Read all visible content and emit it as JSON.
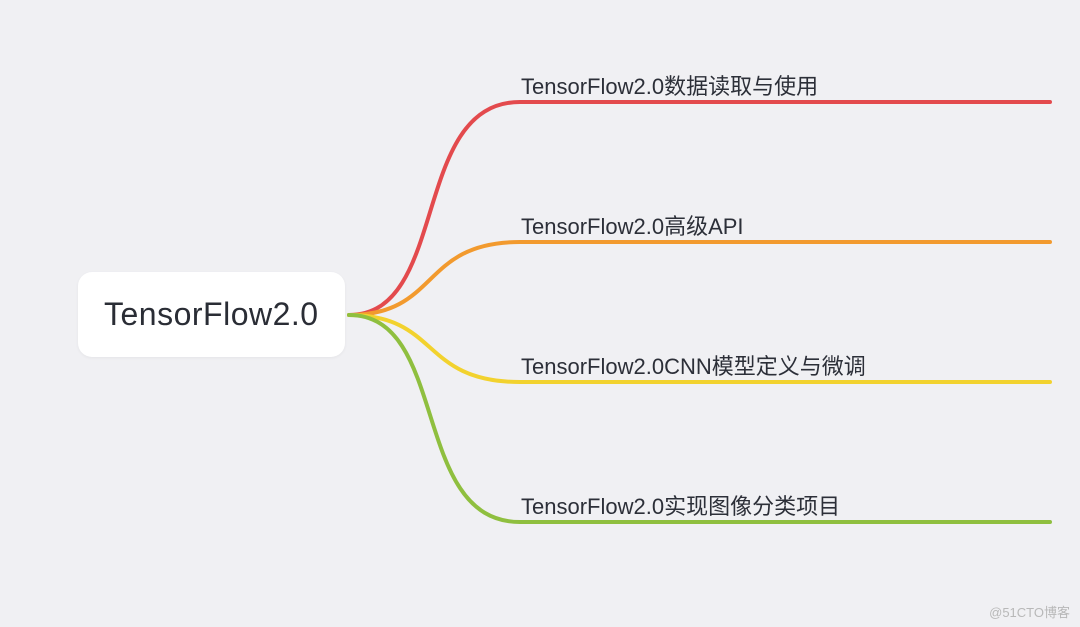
{
  "root": {
    "label": "TensorFlow2.0"
  },
  "branches": [
    {
      "label": "TensorFlow2.0数据读取与使用",
      "color": "#e34a4d"
    },
    {
      "label": "TensorFlow2.0高级API",
      "color": "#f29a2e"
    },
    {
      "label": "TensorFlow2.0CNN模型定义与微调",
      "color": "#f2d22e"
    },
    {
      "label": "TensorFlow2.0实现图像分类项目",
      "color": "#8fbf3f"
    }
  ],
  "watermark": "@51CTO博客"
}
